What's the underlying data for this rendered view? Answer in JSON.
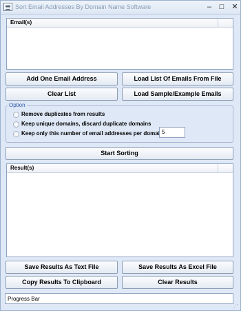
{
  "window": {
    "title": "Sort Email Addresses By Domain Name Software",
    "minimize_glyph": "–",
    "maximize_glyph": "□",
    "close_glyph": "✕"
  },
  "emails_list": {
    "header": "Email(s)"
  },
  "buttons": {
    "add_one": "Add One Email Address",
    "load_list": "Load List Of Emails From File",
    "clear_list": "Clear List",
    "load_sample": "Load Sample/Example Emails",
    "start_sorting": "Start Sorting",
    "save_text": "Save Results As Text File",
    "save_excel": "Save Results As Excel File",
    "copy_clipboard": "Copy Results To Clipboard",
    "clear_results": "Clear Results"
  },
  "option_group": {
    "title": "Option",
    "opt_remove_duplicates": "Remove duplicates from results",
    "opt_keep_unique": "Keep unique domains, discard duplicate domains",
    "opt_keep_only_n": "Keep only this number of email addresses per domain:",
    "count_value": "5"
  },
  "results_list": {
    "header": "Result(s)"
  },
  "status": {
    "progress_label": "Progress Bar"
  }
}
